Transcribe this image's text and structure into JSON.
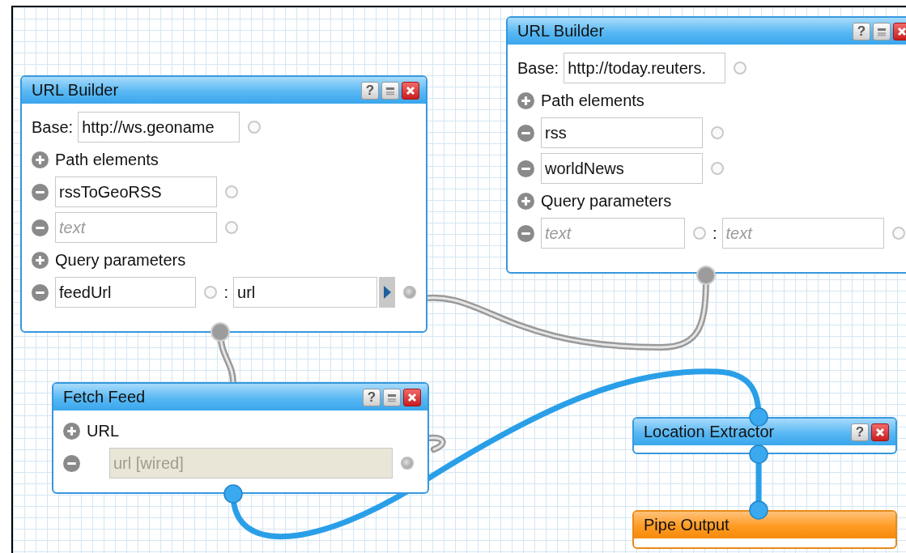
{
  "modules": [
    {
      "kind": "url_builder",
      "title": "URL Builder",
      "buttons": [
        {
          "kind": "help",
          "label": "?"
        },
        {
          "kind": "minimize"
        },
        {
          "kind": "close"
        }
      ],
      "base": {
        "label": "Base:",
        "value": "http://ws.geoname",
        "wired": false
      },
      "path_label": "Path elements",
      "path_elements": [
        {
          "value": "rssToGeoRSS",
          "wired": false
        },
        {
          "placeholder": "text",
          "wired": false
        }
      ],
      "query_label": "Query parameters",
      "query_parameters": [
        {
          "key": {
            "value": "feedUrl",
            "wired": false
          },
          "separator": ":",
          "value": {
            "value": "url",
            "wired": true,
            "expander": true
          }
        }
      ]
    },
    {
      "kind": "url_builder",
      "title": "URL Builder",
      "buttons": [
        {
          "kind": "help",
          "label": "?"
        },
        {
          "kind": "minimize"
        },
        {
          "kind": "close"
        }
      ],
      "base": {
        "label": "Base:",
        "value": "http://today.reuters.",
        "wired": false
      },
      "path_label": "Path elements",
      "path_elements": [
        {
          "value": "rss",
          "wired": false
        },
        {
          "value": "worldNews",
          "wired": false
        }
      ],
      "query_label": "Query parameters",
      "query_parameters": [
        {
          "key": {
            "placeholder": "text",
            "wired": false
          },
          "separator": ":",
          "value": {
            "placeholder": "text",
            "wired": false
          }
        }
      ]
    },
    {
      "kind": "fetch_feed",
      "title": "Fetch Feed",
      "buttons": [
        {
          "kind": "help",
          "label": "?"
        },
        {
          "kind": "minimize"
        },
        {
          "kind": "close"
        }
      ],
      "section_label": "URL",
      "items": [
        {
          "value": "url [wired]",
          "disabled": true,
          "wired": true
        }
      ]
    },
    {
      "kind": "simple",
      "title": "Location Extractor",
      "buttons": [
        {
          "kind": "help",
          "label": "?"
        },
        {
          "kind": "close"
        }
      ]
    },
    {
      "kind": "output",
      "title": "Pipe Output"
    }
  ]
}
